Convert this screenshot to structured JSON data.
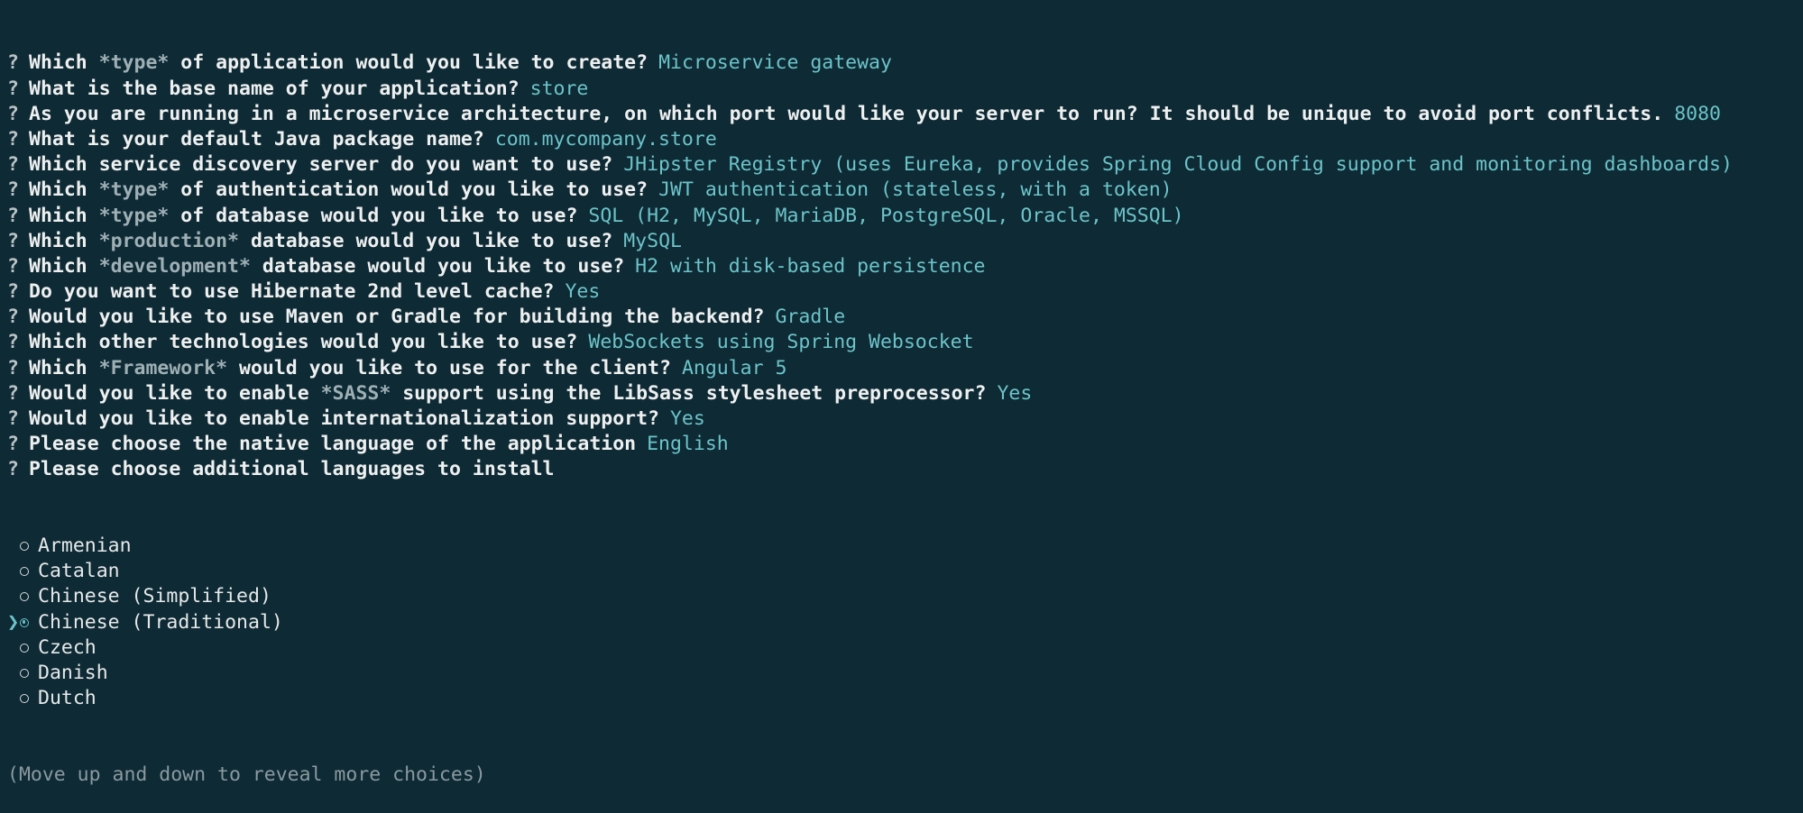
{
  "questions": [
    {
      "parts": [
        {
          "t": "Which "
        },
        {
          "t": "*type*",
          "em": true
        },
        {
          "t": " of application would you like to create?"
        }
      ],
      "answer": "Microservice gateway"
    },
    {
      "parts": [
        {
          "t": "What is the base name of your application?"
        }
      ],
      "answer": "store"
    },
    {
      "parts": [
        {
          "t": "As you are running in a microservice architecture, on which port would like your server to run? It should be unique to avoid port conflicts."
        }
      ],
      "answer": "8080"
    },
    {
      "parts": [
        {
          "t": "What is your default Java package name?"
        }
      ],
      "answer": "com.mycompany.store"
    },
    {
      "parts": [
        {
          "t": "Which service discovery server do you want to use?"
        }
      ],
      "answer": "JHipster Registry (uses Eureka, provides Spring Cloud Config support and monitoring dashboards)"
    },
    {
      "parts": [
        {
          "t": "Which "
        },
        {
          "t": "*type*",
          "em": true
        },
        {
          "t": " of authentication would you like to use?"
        }
      ],
      "answer": "JWT authentication (stateless, with a token)"
    },
    {
      "parts": [
        {
          "t": "Which "
        },
        {
          "t": "*type*",
          "em": true
        },
        {
          "t": " of database would you like to use?"
        }
      ],
      "answer": "SQL (H2, MySQL, MariaDB, PostgreSQL, Oracle, MSSQL)"
    },
    {
      "parts": [
        {
          "t": "Which "
        },
        {
          "t": "*production*",
          "em": true
        },
        {
          "t": " database would you like to use?"
        }
      ],
      "answer": "MySQL"
    },
    {
      "parts": [
        {
          "t": "Which "
        },
        {
          "t": "*development*",
          "em": true
        },
        {
          "t": " database would you like to use?"
        }
      ],
      "answer": "H2 with disk-based persistence"
    },
    {
      "parts": [
        {
          "t": "Do you want to use Hibernate 2nd level cache?"
        }
      ],
      "answer": "Yes"
    },
    {
      "parts": [
        {
          "t": "Would you like to use Maven or Gradle for building the backend?"
        }
      ],
      "answer": "Gradle"
    },
    {
      "parts": [
        {
          "t": "Which other technologies would you like to use?"
        }
      ],
      "answer": "WebSockets using Spring Websocket"
    },
    {
      "parts": [
        {
          "t": "Which "
        },
        {
          "t": "*Framework*",
          "em": true
        },
        {
          "t": " would you like to use for the client?"
        }
      ],
      "answer": "Angular 5"
    },
    {
      "parts": [
        {
          "t": "Would you like to enable "
        },
        {
          "t": "*SASS*",
          "em": true
        },
        {
          "t": " support using the LibSass stylesheet preprocessor?"
        }
      ],
      "answer": "Yes"
    },
    {
      "parts": [
        {
          "t": "Would you like to enable internationalization support?"
        }
      ],
      "answer": "Yes"
    },
    {
      "parts": [
        {
          "t": "Please choose the native language of the application"
        }
      ],
      "answer": "English"
    },
    {
      "parts": [
        {
          "t": "Please choose additional languages to install"
        }
      ],
      "answer": ""
    }
  ],
  "prompt_mark": "?",
  "pointer_glyph": "❯",
  "choices": [
    {
      "label": "Armenian",
      "current": false
    },
    {
      "label": "Catalan",
      "current": false
    },
    {
      "label": "Chinese (Simplified)",
      "current": false
    },
    {
      "label": "Chinese (Traditional)",
      "current": true
    },
    {
      "label": "Czech",
      "current": false
    },
    {
      "label": "Danish",
      "current": false
    },
    {
      "label": "Dutch",
      "current": false
    }
  ],
  "hint": "(Move up and down to reveal more choices)",
  "colors": {
    "background": "#0e2a35",
    "answer": "#6cc4c9",
    "emphasis": "#9fb0b5",
    "hint": "#8a9a9f"
  }
}
